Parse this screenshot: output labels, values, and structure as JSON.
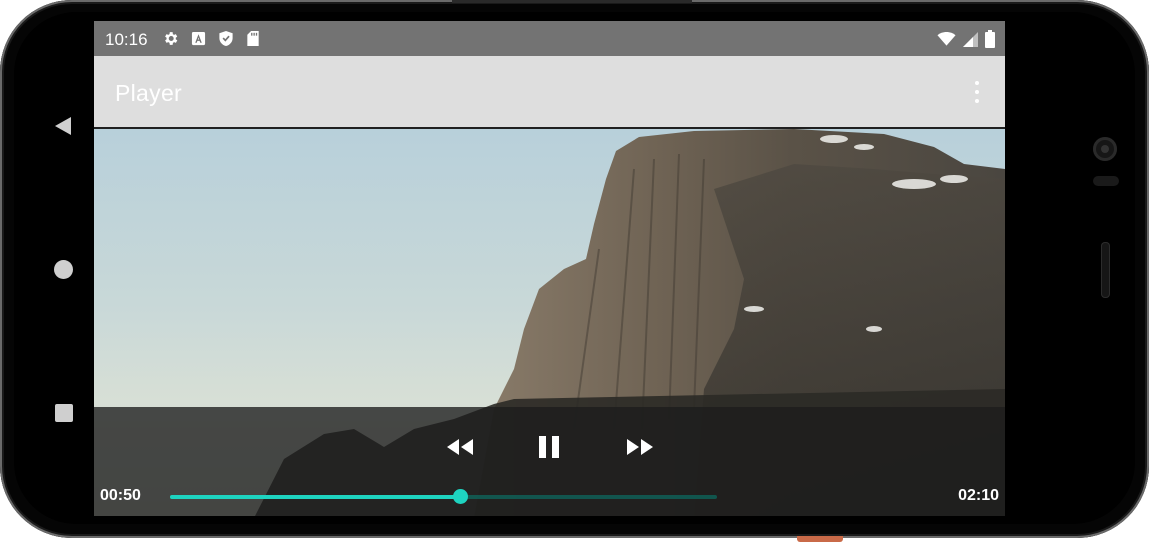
{
  "status_bar": {
    "time": "10:16",
    "left_icons": [
      "settings-icon",
      "a-icon",
      "shield-icon",
      "sd-card-icon"
    ],
    "right_icons": [
      "wifi-icon",
      "signal-icon",
      "battery-icon"
    ]
  },
  "app_bar": {
    "title": "Player",
    "overflow_icon": "more-vert-icon"
  },
  "player": {
    "current_time": "00:50",
    "duration": "02:10",
    "progress": 0.53,
    "buffered": 1.0,
    "state": "playing",
    "controls": [
      "rewind-icon",
      "pause-icon",
      "fast-forward-icon"
    ],
    "accent_color": "#1ED3C0"
  },
  "nav_bar": {
    "buttons": [
      "back-icon",
      "home-icon",
      "recents-icon"
    ]
  }
}
